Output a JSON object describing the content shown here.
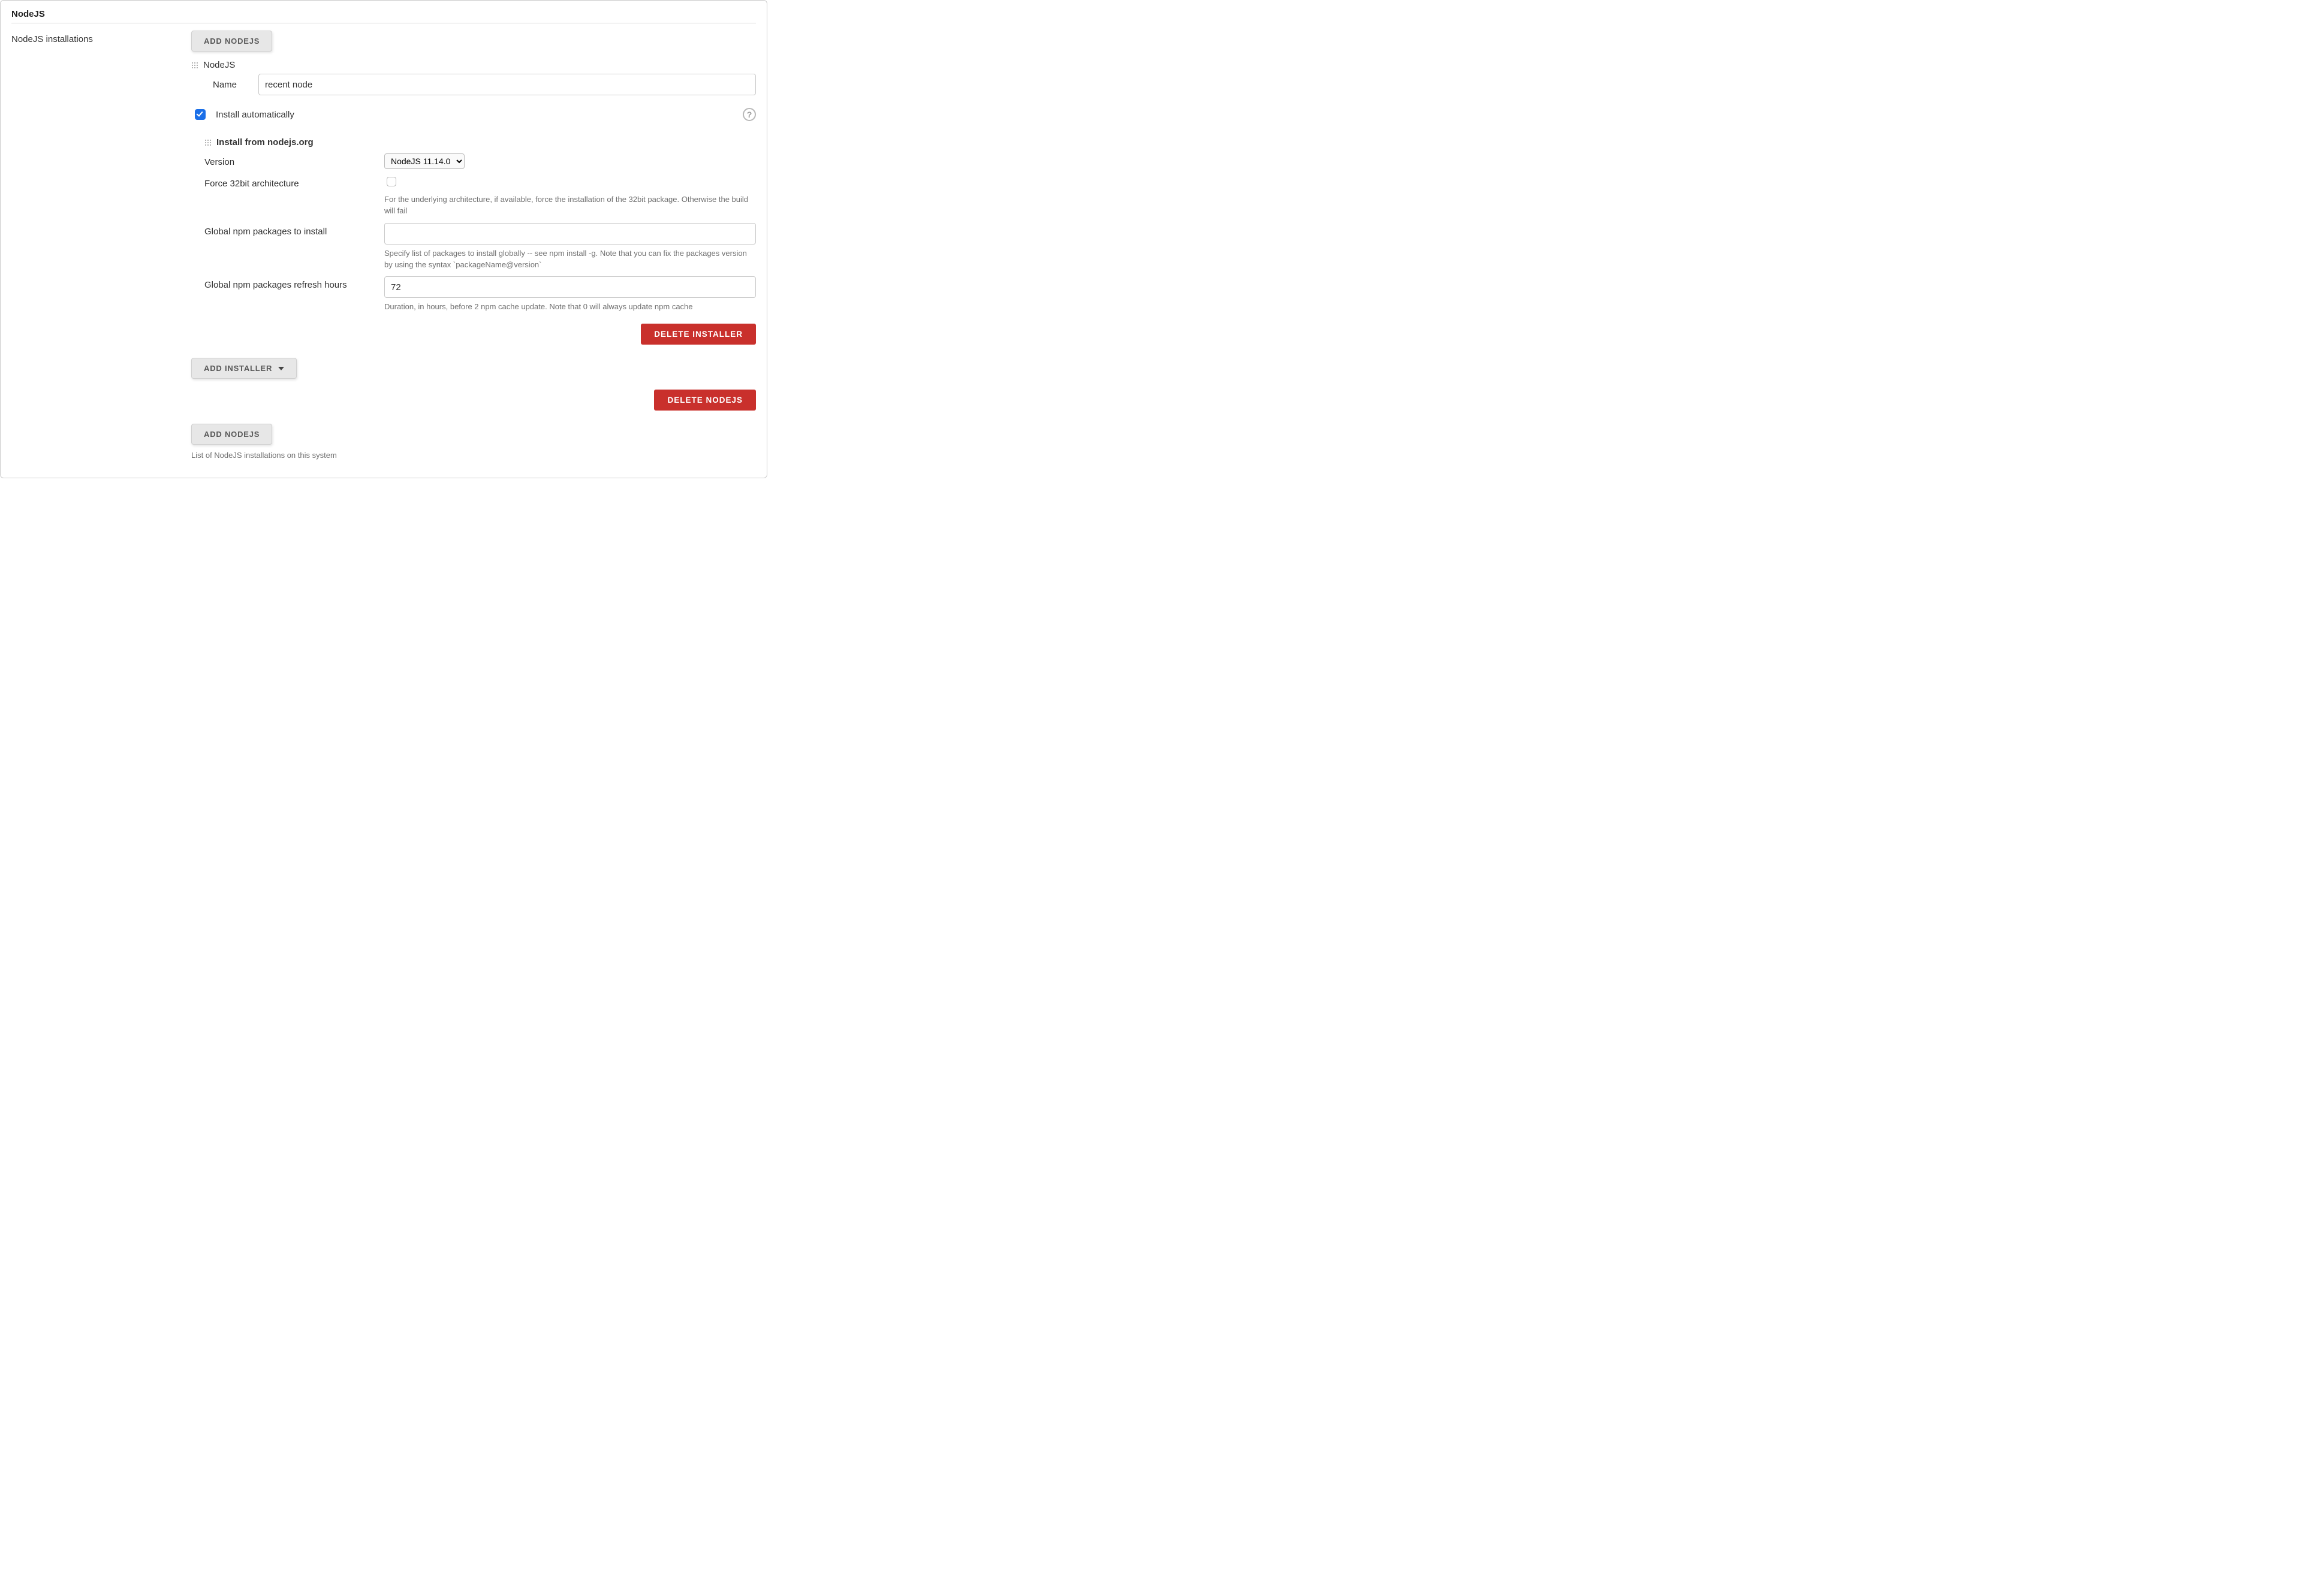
{
  "section": {
    "title": "NodeJS",
    "leftLabel": "NodeJS installations"
  },
  "buttons": {
    "addNodejs": "ADD NODEJS",
    "addInstaller": "ADD INSTALLER",
    "deleteInstaller": "DELETE INSTALLER",
    "deleteNodejs": "DELETE NODEJS"
  },
  "nodeInstall": {
    "header": "NodeJS",
    "nameLabel": "Name",
    "nameValue": "recent node",
    "autoLabel": "Install automatically",
    "autoChecked": true
  },
  "installer": {
    "title": "Install from nodejs.org",
    "versionLabel": "Version",
    "versionValue": "NodeJS 11.14.0",
    "force32Label": "Force 32bit architecture",
    "force32Checked": false,
    "force32Help": "For the underlying architecture, if available, force the installation of the 32bit package. Otherwise the build will fail",
    "globalPkgsLabel": "Global npm packages to install",
    "globalPkgsValue": "",
    "globalPkgsHelp": "Specify list of packages to install globally -- see npm install -g. Note that you can fix the packages version by using the syntax `packageName@version`",
    "refreshLabel": "Global npm packages refresh hours",
    "refreshValue": "72",
    "refreshHelp": "Duration, in hours, before 2 npm cache update. Note that 0 will always update npm cache"
  },
  "footer": {
    "listHelp": "List of NodeJS installations on this system"
  }
}
